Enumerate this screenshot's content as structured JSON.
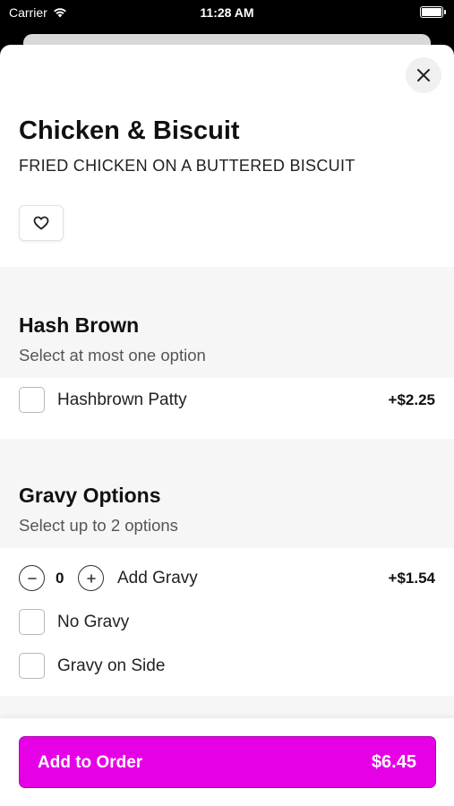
{
  "status_bar": {
    "carrier": "Carrier",
    "time": "11:28 AM",
    "battery_level": 1.0
  },
  "item": {
    "title": "Chicken & Biscuit",
    "description": "FRIED CHICKEN ON A BUTTERED BISCUIT",
    "favorite_icon": "heart-outline-icon",
    "close_icon": "close-icon"
  },
  "sections": [
    {
      "title": "Hash Brown",
      "subtitle": "Select at most one option",
      "options": [
        {
          "label": "Hashbrown Patty",
          "price": "+$2.25",
          "checked": false
        }
      ]
    },
    {
      "title": "Gravy Options",
      "subtitle": "Select up to 2 options",
      "options": [
        {
          "label": "Add Gravy",
          "price": "+$1.54",
          "quantity": "0"
        },
        {
          "label": "No Gravy",
          "checked": false
        },
        {
          "label": "Gravy on Side",
          "checked": false
        }
      ]
    }
  ],
  "footer": {
    "add_label": "Add to Order",
    "total": "$6.45"
  },
  "colors": {
    "accent": "#e600e6",
    "section_bg": "#f6f6f6"
  }
}
